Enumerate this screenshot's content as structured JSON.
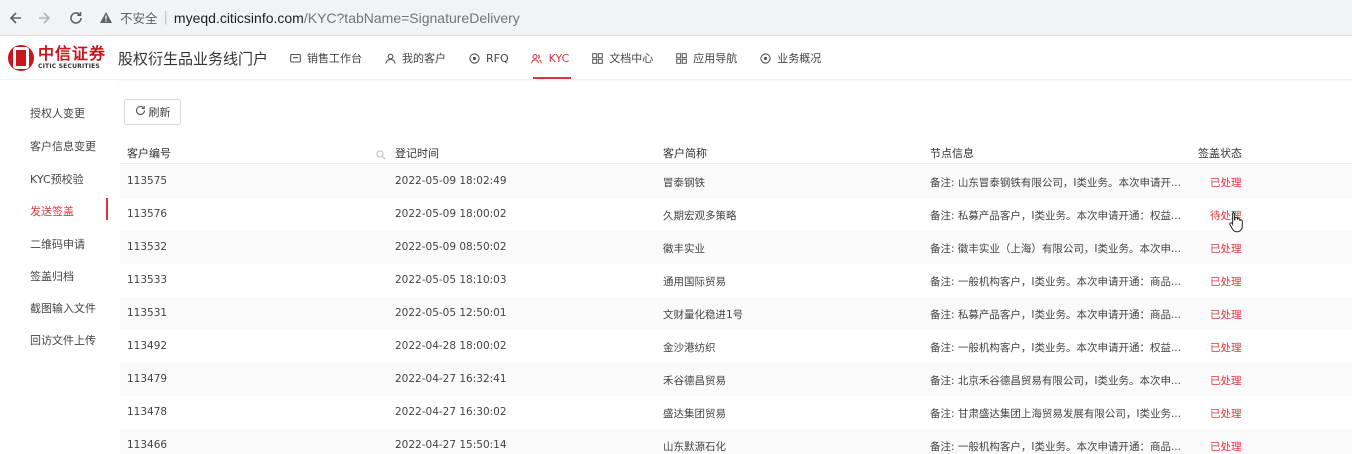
{
  "browser": {
    "insecure_label": "不安全",
    "url_host": "myeqd.citicsinfo.com",
    "url_path": "/KYC?tabName=SignatureDelivery"
  },
  "header": {
    "logo_cn": "中信证券",
    "logo_en": "CITIC SECURITIES",
    "portal_title": "股权衍生品业务线门户",
    "menu": [
      {
        "label": "销售工作台",
        "icon": "workbench-icon"
      },
      {
        "label": "我的客户",
        "icon": "user-icon"
      },
      {
        "label": "RFQ",
        "icon": "target-icon"
      },
      {
        "label": "KYC",
        "icon": "people-icon",
        "active": true
      },
      {
        "label": "文档中心",
        "icon": "grid-icon"
      },
      {
        "label": "应用导航",
        "icon": "apps-icon"
      },
      {
        "label": "业务概况",
        "icon": "overview-icon"
      }
    ]
  },
  "sidebar": {
    "items": [
      {
        "label": "授权人变更"
      },
      {
        "label": "客户信息变更"
      },
      {
        "label": "KYC预校验"
      },
      {
        "label": "发送签盖",
        "active": true
      },
      {
        "label": "二维码申请"
      },
      {
        "label": "签盖归档"
      },
      {
        "label": "截图输入文件"
      },
      {
        "label": "回访文件上传"
      }
    ]
  },
  "toolbar": {
    "refresh_label": "刷新"
  },
  "table": {
    "columns": [
      "客户编号",
      "登记时间",
      "客户简称",
      "节点信息",
      "签盖状态"
    ],
    "rows": [
      {
        "id": "113575",
        "time": "2022-05-09 18:02:49",
        "name": "冒泰钢铁",
        "node": "备注: 山东冒泰钢铁有限公司，I类业务。本次申请开...",
        "status": "已处理"
      },
      {
        "id": "113576",
        "time": "2022-05-09 18:00:02",
        "name": "久期宏观多策略",
        "node": "备注: 私募产品客户，I类业务。本次申请开通：权益...",
        "status": "待处理"
      },
      {
        "id": "113532",
        "time": "2022-05-09 08:50:02",
        "name": "徽丰实业",
        "node": "备注: 徽丰实业（上海）有限公司，I类业务。本次申...",
        "status": "已处理"
      },
      {
        "id": "113533",
        "time": "2022-05-05 18:10:03",
        "name": "通用国际贸易",
        "node": "备注: 一般机构客户，I类业务。本次申请开通：商品...",
        "status": "已处理"
      },
      {
        "id": "113531",
        "time": "2022-05-05 12:50:01",
        "name": "文财量化稳进1号",
        "node": "备注: 私募产品客户，I类业务。本次申请开通：商品...",
        "status": "已处理"
      },
      {
        "id": "113492",
        "time": "2022-04-28 18:00:02",
        "name": "金沙港纺织",
        "node": "备注: 一般机构客户，I类业务。本次申请开通：权益...",
        "status": "已处理"
      },
      {
        "id": "113479",
        "time": "2022-04-27 16:32:41",
        "name": "禾谷德昌贸易",
        "node": "备注: 北京禾谷德昌贸易有限公司，I类业务。本次申...",
        "status": "已处理"
      },
      {
        "id": "113478",
        "time": "2022-04-27 16:30:02",
        "name": "盛达集团贸易",
        "node": "备注: 甘肃盛达集团上海贸易发展有限公司，I类业务...",
        "status": "已处理"
      },
      {
        "id": "113466",
        "time": "2022-04-27 15:50:14",
        "name": "山东默源石化",
        "node": "备注: 一般机构客户，I类业务。本次申请开通：商品...",
        "status": "已处理"
      }
    ]
  },
  "colors": {
    "accent": "#d9363e",
    "brand": "#c8161d"
  }
}
